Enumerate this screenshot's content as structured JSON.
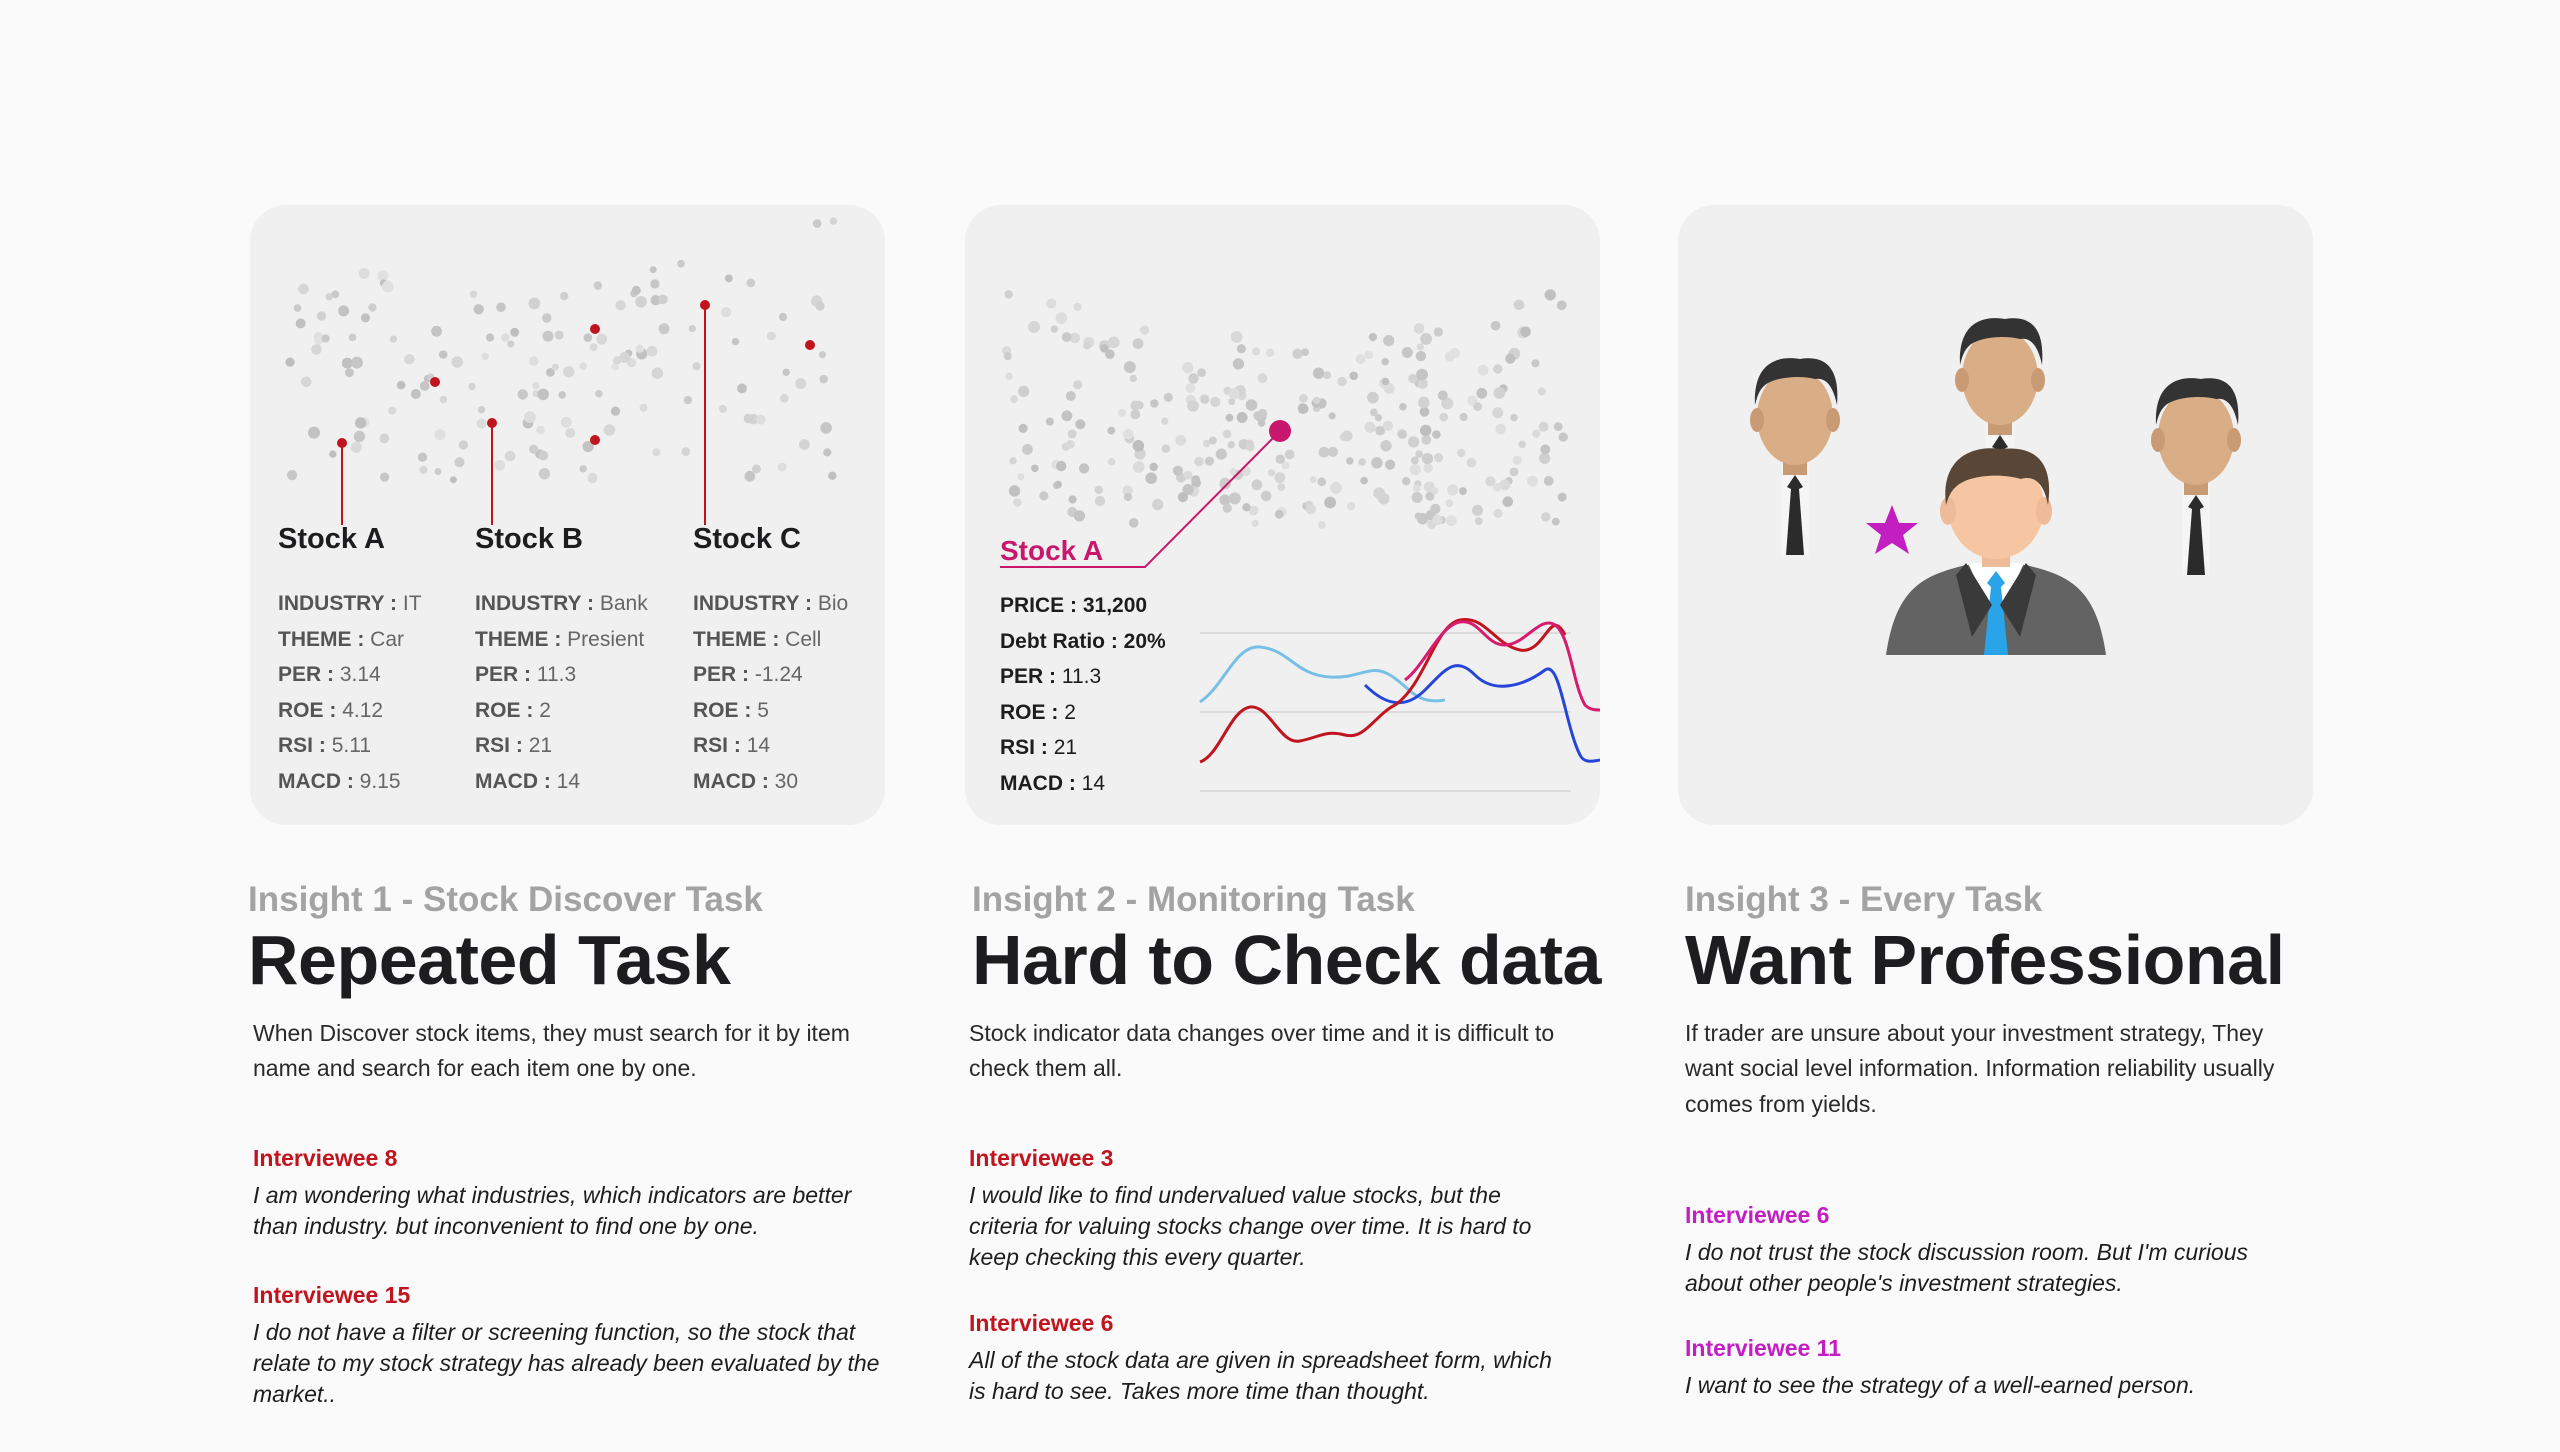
{
  "card1": {
    "stocks": [
      {
        "name": "Stock A",
        "rows": [
          [
            "INDUSTRY :",
            "IT"
          ],
          [
            "THEME :",
            "Car"
          ],
          [
            "PER :",
            "3.14"
          ],
          [
            "ROE :",
            "4.12"
          ],
          [
            "RSI :",
            "5.11"
          ],
          [
            "MACD :",
            "9.15"
          ]
        ]
      },
      {
        "name": "Stock B",
        "rows": [
          [
            "INDUSTRY :",
            "Bank"
          ],
          [
            "THEME :",
            "Presient"
          ],
          [
            "PER :",
            "11.3"
          ],
          [
            "ROE :",
            "2"
          ],
          [
            "RSI :",
            "21"
          ],
          [
            "MACD :",
            "14"
          ]
        ]
      },
      {
        "name": "Stock C",
        "rows": [
          [
            "INDUSTRY :",
            "Bio"
          ],
          [
            "THEME :",
            "Cell"
          ],
          [
            "PER :",
            "-1.24"
          ],
          [
            "ROE :",
            "5"
          ],
          [
            "RSI :",
            "14"
          ],
          [
            "MACD :",
            "30"
          ]
        ]
      }
    ]
  },
  "card2": {
    "stock_name": "Stock A",
    "rows": [
      [
        "PRICE :",
        "31,200"
      ],
      [
        "Debt Ratio :",
        "20%"
      ],
      [
        "PER :",
        "11.3"
      ],
      [
        "ROE :",
        "2"
      ],
      [
        "RSI :",
        "21"
      ],
      [
        "MACD :",
        "14"
      ]
    ]
  },
  "insights": [
    {
      "label": "Insight 1 - Stock Discover Task",
      "headline": "Repeated Task",
      "description": "When Discover stock items, they must search for it by item name and search for each item one by one.",
      "quotes": [
        {
          "name": "Interviewee 8",
          "text": "I am wondering what industries, which indicators are better than industry. but inconvenient to find one by one."
        },
        {
          "name": "Interviewee 15",
          "text": "I do not have a filter or screening function, so the stock that relate to my stock strategy has already been evaluated by the market.."
        }
      ]
    },
    {
      "label": "Insight 2 - Monitoring Task",
      "headline": "Hard to Check data",
      "description": "Stock indicator data changes over time and it is difficult to check them all.",
      "quotes": [
        {
          "name": "Interviewee 3",
          "text": "I would like to find undervalued value stocks, but the criteria for valuing stocks change over time. It is hard to keep checking this every quarter."
        },
        {
          "name": "Interviewee 6",
          "text": "All of the stock data are given in spreadsheet form, which is hard to see. Takes more time than thought."
        }
      ]
    },
    {
      "label": "Insight 3 - Every Task",
      "headline": "Want Professional",
      "description": "If trader are unsure about your investment strategy, They want social level information. Information reliability usually comes from yields.",
      "quotes": [
        {
          "name": "Interviewee 6",
          "text": "I do not trust the stock discussion room. But I'm curious about other people's investment strategies."
        },
        {
          "name": "Interviewee 11",
          "text": "I want to see the strategy of a well-earned person."
        }
      ]
    }
  ],
  "colors": {
    "red": "#c0141e",
    "magenta": "#c21ec2",
    "pink": "#c8186e",
    "star": "#c21ec2"
  },
  "icons": [
    "person-icon",
    "star-icon"
  ]
}
